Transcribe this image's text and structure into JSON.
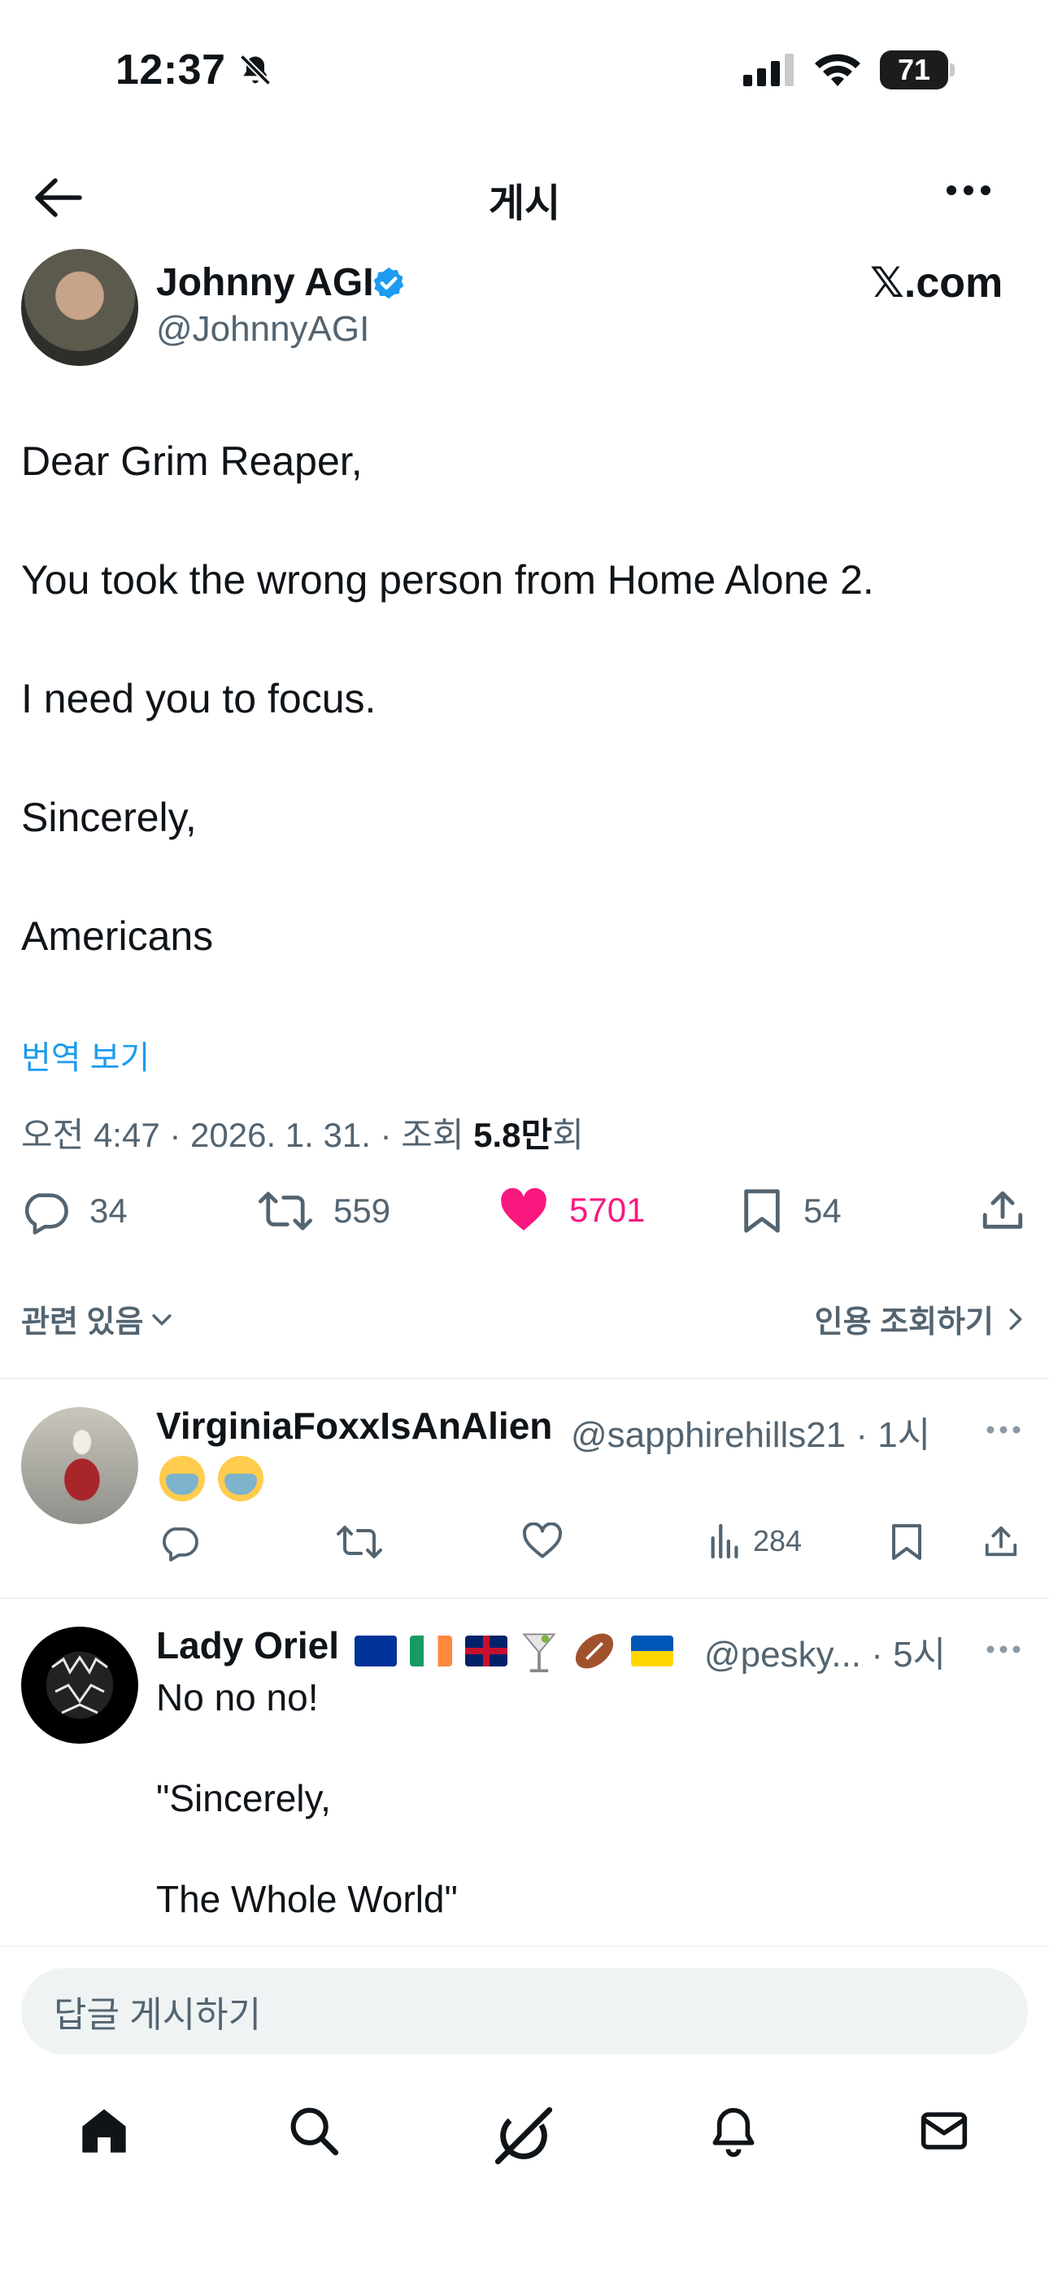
{
  "status_bar": {
    "time": "12:37",
    "battery": "71"
  },
  "header": {
    "title": "게시"
  },
  "post": {
    "author_name": "Johnny AGI",
    "author_handle": "@JohnnyAGI",
    "source_badge": "𝕏.com",
    "body_lines": [
      "Dear Grim Reaper,",
      "You took the wrong person from Home Alone 2.",
      "I need you to focus.",
      "Sincerely,",
      "Americans"
    ],
    "translate_label": "번역 보기",
    "meta_prefix": "오전 4:47 · 2026. 1. 31. · 조회 ",
    "views_count": "5.8만",
    "views_suffix": "회",
    "stats": {
      "replies": "34",
      "reposts": "559",
      "likes": "5701",
      "bookmarks": "54"
    },
    "related_label": "관련 있음",
    "quotes_label": "인용 조회하기"
  },
  "replies": [
    {
      "name": "VirginiaFoxxIsAnAlien",
      "handle_time": "@sapphirehills21 · 1시",
      "views": "284"
    },
    {
      "name": "Lady Oriel",
      "handle_time": "@pesky... · 5시",
      "lines": [
        "No no no!",
        "\"Sincerely,",
        "The Whole World\""
      ]
    }
  ],
  "composer": {
    "placeholder": "답글 게시하기"
  },
  "colors": {
    "like": "#f91880",
    "verified": "#1d9bf0",
    "link": "#1d9bf0",
    "muted": "#536471"
  }
}
